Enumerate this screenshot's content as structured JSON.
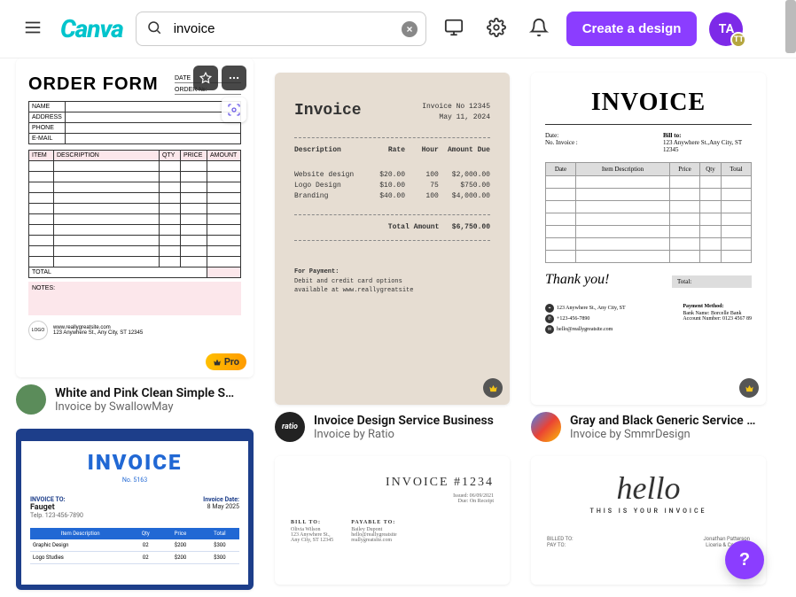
{
  "header": {
    "logo": "Canva",
    "search_value": "invoice",
    "create_label": "Create a design",
    "avatar_initials": "TA",
    "avatar_badge": "TT"
  },
  "templates": {
    "t1": {
      "title": "ORDER FORM",
      "date_label": "DATE",
      "orderno_label": "ORDER №:",
      "info_rows": [
        "NAME",
        "ADDRESS",
        "PHONE",
        "E-MAIL"
      ],
      "headers": [
        "ITEM",
        "DESCRIPTION",
        "QTY",
        "PRICE",
        "AMOUNT"
      ],
      "total_label": "TOTAL",
      "notes_label": "NOTES:",
      "footer_site": "www.reallygreatsite.com",
      "footer_addr": "123 Anywhere St., Any City, ST 12345",
      "pro_label": "Pro",
      "meta_title": "White and Pink Clean Simple S…",
      "meta_sub": "Invoice by SwallowMay"
    },
    "t4": {
      "title": "INVOICE",
      "no": "No. 5163",
      "to_label": "INVOICE TO:",
      "to_name": "Fauget",
      "to_phone": "Telp. 123-456-7890",
      "date_label": "Invoice Date:",
      "date_val": "8 May 2025",
      "headers": [
        "Item Description",
        "Qty",
        "Price",
        "Total"
      ],
      "rows": [
        [
          "Graphic Design",
          "02",
          "$200",
          "$300"
        ],
        [
          "Logo Studies",
          "02",
          "$200",
          "$300"
        ]
      ]
    },
    "t2": {
      "title": "Invoice",
      "inv_no": "Invoice No 12345",
      "inv_date": "May 11, 2024",
      "headers": [
        "Description",
        "Rate",
        "Hour",
        "Amount Due"
      ],
      "rows": [
        [
          "Website design",
          "$20.00",
          "100",
          "$2,000.00"
        ],
        [
          "Logo Design",
          "$10.00",
          "75",
          "$750.00"
        ],
        [
          "Branding",
          "$40.00",
          "100",
          "$4,000.00"
        ]
      ],
      "total_label": "Total Amount",
      "total_val": "$6,750.00",
      "pay_head": "For Payment:",
      "pay_l1": "Debit and credit card options",
      "pay_l2": "available at www.reallygreatsite",
      "meta_title": "Invoice Design Service Business",
      "meta_sub": "Invoice by Ratio"
    },
    "t5": {
      "title": "INVOICE #1234",
      "issued": "Issued: 06/09/2021",
      "due": "Due: On Receipt",
      "bill_label": "BILL TO:",
      "bill_name": "Olivia Wilson",
      "bill_l1": "123 Anywhere St.,",
      "bill_l2": "Any City, ST 12345",
      "pay_label": "PAYABLE TO:",
      "pay_name": "Bailey Dupont",
      "pay_l1": "hello@reallygreatsite",
      "pay_l2": "reallygreatsite.com"
    },
    "t3": {
      "title": "INVOICE",
      "date_label": "Date:",
      "noinv_label": "No. Invoice :",
      "billto_label": "Bill to:",
      "billto_val": "123 Anywhere St.,Any City, ST 12345",
      "headers": [
        "Date",
        "Item Description",
        "Price",
        "Qty",
        "Total"
      ],
      "thanks": "Thank you!",
      "total_label": "Total:",
      "addr": "123 Anywhere St., Any City, ST",
      "phone": "+123-456-7890",
      "email": "hello@reallygreatsite.com",
      "paymethod": "Payment Method:",
      "bank": "Bank Name: Borcelle Bank",
      "acct": "Account Number: 0123 4567 89",
      "meta_title": "Gray and Black Generic Service …",
      "meta_sub": "Invoice by SmmrDesign"
    },
    "t6": {
      "hello": "hello",
      "sub": "THIS IS YOUR INVOICE",
      "billed": "BILLED TO:",
      "payto": "PAY TO:",
      "name": "Jonathan Patterson",
      "co": "Liceria & Company"
    }
  },
  "help_label": "?"
}
